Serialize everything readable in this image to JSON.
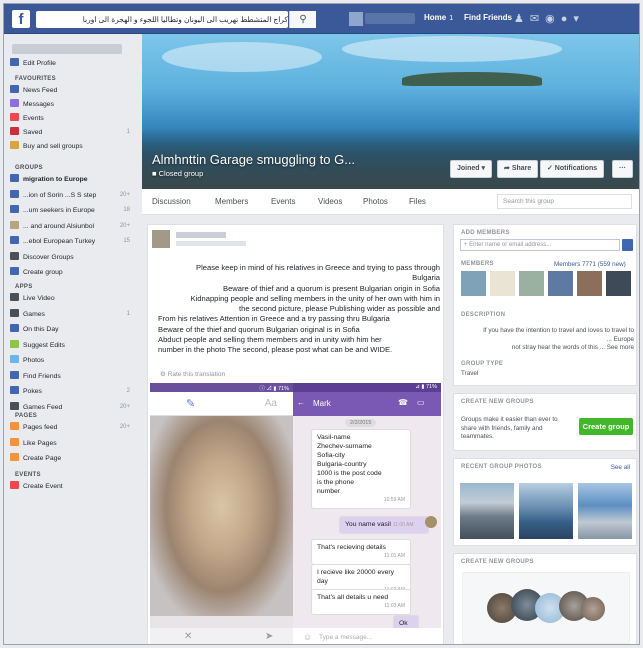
{
  "topbar": {
    "search_value": "كراج المتشطط تهريب الى اليونان وتطاليا اللجوء و الهجرة الى اوربا",
    "home_label": "Home",
    "home_badge": "1",
    "find_friends_label": "Find Friends",
    "accent": "#3b5998",
    "logo_letter": "f"
  },
  "sidebar": {
    "edit_profile": "Edit Profile",
    "favourites_title": "FAVOURITES",
    "favourites": [
      {
        "label": "News Feed",
        "count": "",
        "color": "#4267b2"
      },
      {
        "label": "Messages",
        "count": "",
        "color": "#8d6de2"
      },
      {
        "label": "Events",
        "count": "",
        "color": "#e94a4a"
      },
      {
        "label": "Saved",
        "count": "1",
        "color": "#c9303a"
      },
      {
        "label": "Buy and sell groups",
        "count": "",
        "color": "#d8a43b"
      }
    ],
    "groups_title": "GROUPS",
    "groups": [
      {
        "label": "migration to Europe",
        "count": "",
        "active": true,
        "color": "#4267b2"
      },
      {
        "label": "...ion of Sorin ...S S step",
        "count": "20+",
        "color": "#4267b2"
      },
      {
        "label": "...um seekers in Europe",
        "count": "18",
        "color": "#4267b2"
      },
      {
        "label": "... and around Alsiunbol",
        "count": "20+",
        "color": "#b7a67c"
      },
      {
        "label": "...ebol European Turkey",
        "count": "15",
        "color": "#4267b2"
      },
      {
        "label": "Discover Groups",
        "count": "",
        "color": "#4b4f56"
      },
      {
        "label": "Create group",
        "count": "",
        "color": "#4267b2"
      }
    ],
    "apps_title": "APPS",
    "apps": [
      {
        "label": "Live Video",
        "count": "",
        "color": "#4b4f56"
      },
      {
        "label": "Games",
        "count": "1",
        "color": "#4b4f56"
      },
      {
        "label": "On this Day",
        "count": "",
        "color": "#4267b2"
      },
      {
        "label": "Suggest Edits",
        "count": "",
        "color": "#8dc63f"
      },
      {
        "label": "Photos",
        "count": "",
        "color": "#6bb6e8"
      },
      {
        "label": "Find Friends",
        "count": "",
        "color": "#4267b2"
      },
      {
        "label": "Pokes",
        "count": "2",
        "color": "#4267b2"
      },
      {
        "label": "Games Feed",
        "count": "20+",
        "color": "#4b4f56"
      }
    ],
    "pages_title": "PAGES",
    "pages": [
      {
        "label": "Pages feed",
        "count": "20+",
        "color": "#f7923a"
      },
      {
        "label": "Like Pages",
        "count": "",
        "color": "#f7923a"
      },
      {
        "label": "Create Page",
        "count": "",
        "color": "#f7923a"
      }
    ],
    "events_title": "EVENTS",
    "events": [
      {
        "label": "Create Event",
        "count": "",
        "color": "#e94a4a"
      }
    ]
  },
  "cover": {
    "title": "Almhnttin Garage smuggling to G...",
    "subtitle": "Closed group",
    "joined_label": "Joined ▾",
    "share_label": "Share",
    "notifications_label": "✓ Notifications",
    "more_label": "···"
  },
  "tabs": {
    "items": [
      "Discussion",
      "Members",
      "Events",
      "Videos",
      "Photos",
      "Files"
    ],
    "search_placeholder": "Search this group"
  },
  "post": {
    "lines": [
      {
        "text": "Please keep in mind of his relatives in Greece and trying to pass through",
        "align": "r"
      },
      {
        "text": "Bulgaria",
        "align": "r"
      },
      {
        "text": "Beware of thief and a quorum is present Bulgarian origin in Sofia",
        "align": "r"
      },
      {
        "text": "Kidnapping people and selling members in the unity of her own with him in",
        "align": "r"
      },
      {
        "text": "the second picture, please Publishing wider as possible and",
        "align": "r"
      },
      {
        "text": "From his relatives Attention in Greece and a try passing thru Bulgaria",
        "align": "l"
      },
      {
        "text": "Beware of the thief and quorum Bulgarian original is in Sofia",
        "align": "l"
      },
      {
        "text": "Abduct people and selling them members and in unity with him her",
        "align": "l"
      },
      {
        "text": "number in the photo The second, please post what can be and WIDE.",
        "align": "l"
      }
    ],
    "rate_label": "Rate this translation",
    "left_phone": {
      "status": "ⓘ ⊿ ▮ 71%",
      "aa_label": "Aa",
      "pencil": "✎",
      "bottom_x": "✕",
      "bottom_send": "➤"
    },
    "right_phone": {
      "status": "⊿ ▮ 71%",
      "contact": "Mark",
      "date_chip": "2/2/2015",
      "msg1_lines": [
        "Vasil-name",
        "Zhechev-surname",
        "Sofia-city",
        "Bulgaria-country",
        "1000 is the post code",
        "is the phone",
        "number"
      ],
      "msg1_time": "10:59 AM",
      "msg2": "You name vasil",
      "msg2_time": "11:00 AM",
      "msg3": "That's recieving details",
      "msg3_time": "11:01 AM",
      "msg4_lines": [
        "I recieve like 20000 every day"
      ],
      "msg4_time": "11:02 AM",
      "msg5": "That's all details u need",
      "msg5_time": "11:03 AM",
      "msg6": "Ok",
      "input_placeholder": "Type a message..."
    }
  },
  "right": {
    "add_members_title": "ADD MEMBERS",
    "add_members_placeholder": "+ Enter name or email address...",
    "members_title": "MEMBERS",
    "members_count": "Members 7771",
    "members_new": "(559 new)",
    "description_title": "DESCRIPTION",
    "description_lines": [
      "If you have the intention to travel and loves to travel to",
      "... Europe",
      "not stray hear the words of this ... See more"
    ],
    "group_type_title": "GROUP TYPE",
    "group_type": "Travel",
    "create_groups_title": "CREATE NEW GROUPS",
    "create_groups_text": [
      "Groups make it easier than ever to",
      "share with friends, family and",
      "teammates."
    ],
    "create_group_btn": "Create group",
    "recent_photos_title": "RECENT GROUP PHOTOS",
    "see_all": "See all",
    "create_groups_title2": "CREATE NEW GROUPS"
  }
}
